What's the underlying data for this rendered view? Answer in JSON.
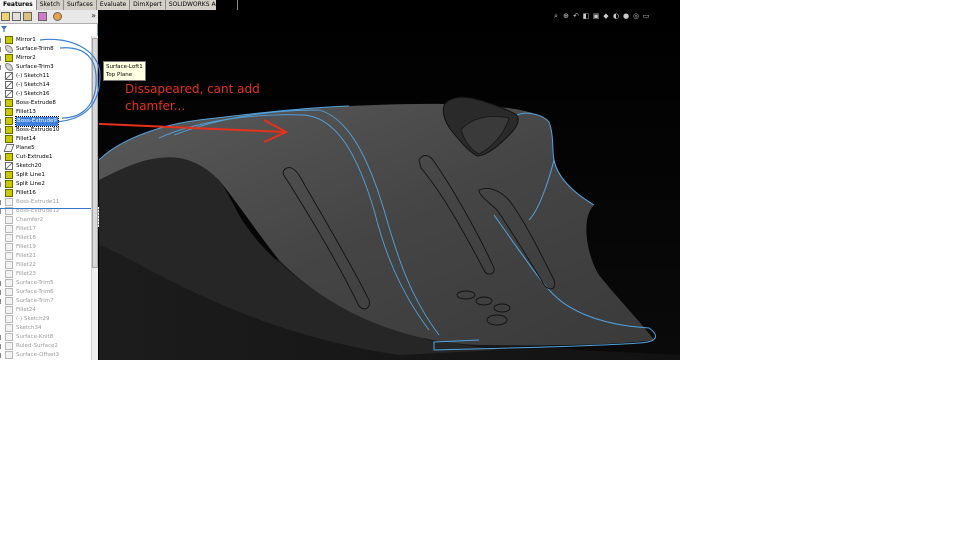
{
  "tabs": [
    {
      "label": "Features",
      "active": true
    },
    {
      "label": "Sketch",
      "active": false
    },
    {
      "label": "Surfaces",
      "active": false
    },
    {
      "label": "Evaluate",
      "active": false
    },
    {
      "label": "DimXpert",
      "active": false
    },
    {
      "label": "SOLIDWORKS Add-Ins",
      "active": false
    }
  ],
  "feature_tree": [
    {
      "label": "Mirror1",
      "icon": "mirror-icon",
      "kind": "feat",
      "expandable": true,
      "suppressed": false
    },
    {
      "label": "Surface-Trim8",
      "icon": "surface-trim-icon",
      "kind": "surf",
      "expandable": true,
      "suppressed": false
    },
    {
      "label": "Mirror2",
      "icon": "mirror-icon",
      "kind": "feat",
      "expandable": true,
      "suppressed": false
    },
    {
      "label": "Surface-Trim3",
      "icon": "surface-trim-icon",
      "kind": "surf",
      "expandable": true,
      "suppressed": false
    },
    {
      "label": "(-) Sketch11",
      "icon": "sketch-icon",
      "kind": "sk",
      "expandable": false,
      "suppressed": false
    },
    {
      "label": "(-) Sketch14",
      "icon": "sketch-icon",
      "kind": "sk",
      "expandable": false,
      "suppressed": false
    },
    {
      "label": "(-) Sketch16",
      "icon": "sketch-icon",
      "kind": "sk",
      "expandable": false,
      "suppressed": false
    },
    {
      "label": "Boss-Extrude8",
      "icon": "boss-extrude-icon",
      "kind": "feat",
      "expandable": true,
      "suppressed": false
    },
    {
      "label": "Fillet13",
      "icon": "fillet-icon",
      "kind": "feat",
      "expandable": false,
      "suppressed": false
    },
    {
      "label": "Boss-Extrude9",
      "icon": "boss-extrude-icon",
      "kind": "feat",
      "expandable": true,
      "suppressed": false,
      "selected": true
    },
    {
      "label": "Boss-Extrude10",
      "icon": "boss-extrude-icon",
      "kind": "feat",
      "expandable": true,
      "suppressed": false
    },
    {
      "label": "Fillet14",
      "icon": "fillet-icon",
      "kind": "feat",
      "expandable": false,
      "suppressed": false
    },
    {
      "label": "Plane5",
      "icon": "plane-icon",
      "kind": "plane",
      "expandable": false,
      "suppressed": false
    },
    {
      "label": "Cut-Extrude1",
      "icon": "cut-extrude-icon",
      "kind": "feat",
      "expandable": true,
      "suppressed": false
    },
    {
      "label": "Sketch20",
      "icon": "sketch-icon",
      "kind": "sk",
      "expandable": false,
      "suppressed": false
    },
    {
      "label": "Split Line1",
      "icon": "split-line-icon",
      "kind": "feat",
      "expandable": true,
      "suppressed": false
    },
    {
      "label": "Split Line2",
      "icon": "split-line-icon",
      "kind": "feat",
      "expandable": true,
      "suppressed": false
    },
    {
      "label": "Fillet16",
      "icon": "fillet-icon",
      "kind": "feat",
      "expandable": false,
      "suppressed": false
    },
    {
      "label": "Boss-Extrude11",
      "icon": "boss-extrude-icon",
      "kind": "sup",
      "expandable": true,
      "suppressed": true
    },
    {
      "label": "Boss-Extrude12",
      "icon": "boss-extrude-icon",
      "kind": "sup",
      "expandable": true,
      "suppressed": true
    },
    {
      "label": "Chamfer2",
      "icon": "chamfer-icon",
      "kind": "sup",
      "expandable": false,
      "suppressed": true
    },
    {
      "label": "Fillet17",
      "icon": "fillet-icon",
      "kind": "sup",
      "expandable": false,
      "suppressed": true
    },
    {
      "label": "Fillet18",
      "icon": "fillet-icon",
      "kind": "sup",
      "expandable": false,
      "suppressed": true
    },
    {
      "label": "Fillet19",
      "icon": "fillet-icon",
      "kind": "sup",
      "expandable": false,
      "suppressed": true
    },
    {
      "label": "Fillet21",
      "icon": "fillet-icon",
      "kind": "sup",
      "expandable": false,
      "suppressed": true
    },
    {
      "label": "Fillet22",
      "icon": "fillet-icon",
      "kind": "sup",
      "expandable": false,
      "suppressed": true
    },
    {
      "label": "Fillet23",
      "icon": "fillet-icon",
      "kind": "sup",
      "expandable": false,
      "suppressed": true
    },
    {
      "label": "Surface-Trim5",
      "icon": "surface-trim-icon",
      "kind": "sup",
      "expandable": true,
      "suppressed": true
    },
    {
      "label": "Surface-Trim6",
      "icon": "surface-trim-icon",
      "kind": "sup",
      "expandable": true,
      "suppressed": true
    },
    {
      "label": "Surface-Trim7",
      "icon": "surface-trim-icon",
      "kind": "sup",
      "expandable": true,
      "suppressed": true
    },
    {
      "label": "Fillet24",
      "icon": "fillet-icon",
      "kind": "sup",
      "expandable": false,
      "suppressed": true
    },
    {
      "label": "(-) Sketch29",
      "icon": "sketch-icon",
      "kind": "sup",
      "expandable": false,
      "suppressed": true
    },
    {
      "label": "Sketch34",
      "icon": "sketch-icon",
      "kind": "sup",
      "expandable": false,
      "suppressed": true
    },
    {
      "label": "Surface-Knit8",
      "icon": "surface-knit-icon",
      "kind": "sup",
      "expandable": true,
      "suppressed": true
    },
    {
      "label": "Ruled-Surface2",
      "icon": "ruled-surface-icon",
      "kind": "sup",
      "expandable": true,
      "suppressed": true
    },
    {
      "label": "Surface-Offset3",
      "icon": "surface-offset-icon",
      "kind": "sup",
      "expandable": true,
      "suppressed": true
    }
  ],
  "tooltip": {
    "line1": "Surface-Loft1",
    "line2": "Top Plane"
  },
  "annotation": {
    "line1": "Dissapeared, cant add",
    "line2": "chamfer..."
  },
  "colors": {
    "annotation": "#e8301c",
    "selection": "#3c7fdc",
    "edge_highlight": "#4fa3e0",
    "model_surface": "#4a4a4a"
  },
  "hud_icons": [
    "zoom-to-fit-icon",
    "zoom-area-icon",
    "previous-view-icon",
    "section-view-icon",
    "view-orientation-icon",
    "display-style-icon",
    "hide-show-icon",
    "edit-appearance-icon",
    "scene-icon",
    "view-settings-icon"
  ]
}
